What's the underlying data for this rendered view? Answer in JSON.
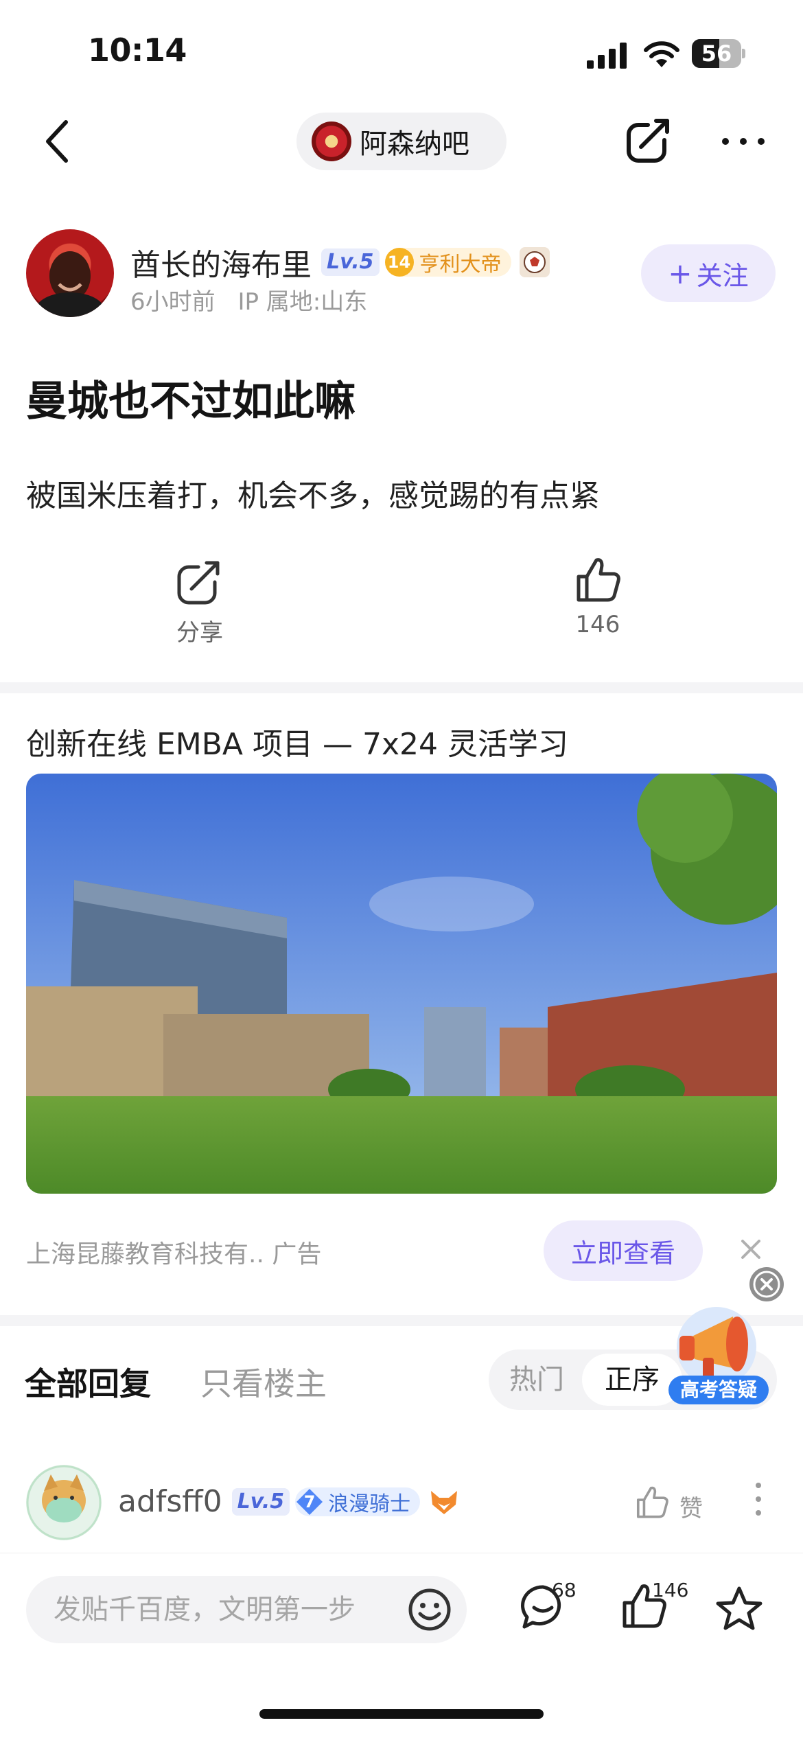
{
  "status_bar": {
    "time": "10:14",
    "battery": "56",
    "battery_level": 0.56
  },
  "nav": {
    "forum_name": "阿森纳吧"
  },
  "author": {
    "name": "酋长的海布里",
    "level": "Lv.5",
    "title_level": "14",
    "title": "亨利大帝",
    "time": "6小时前",
    "ip": "IP 属地:山东",
    "follow_label": "关注"
  },
  "post": {
    "title": "曼城也不过如此嘛",
    "body": "被国米压着打，机会不多，感觉踢的有点紧",
    "share_label": "分享",
    "like_count": "146"
  },
  "ad": {
    "title": "创新在线 EMBA 项目 — 7x24 灵活学习",
    "source": "上海昆藤教育科技有..  广告",
    "cta_label": "立即查看"
  },
  "replies": {
    "tab_all": "全部回复",
    "tab_owner": "只看楼主",
    "sort_hot": "热门",
    "sort_asc": "正序",
    "promo_label": "高考答疑"
  },
  "comment": {
    "name": "adfsff0",
    "level": "Lv.5",
    "title_level": "7",
    "title": "浪漫骑士",
    "like_label": "赞"
  },
  "bottom_bar": {
    "input_placeholder": "发贴千百度，文明第一步",
    "comment_count": "68",
    "like_count": "146"
  },
  "colors": {
    "accent": "#6a57e8",
    "level_badge": "#4a66d9",
    "title_badge": "#e2901a"
  }
}
